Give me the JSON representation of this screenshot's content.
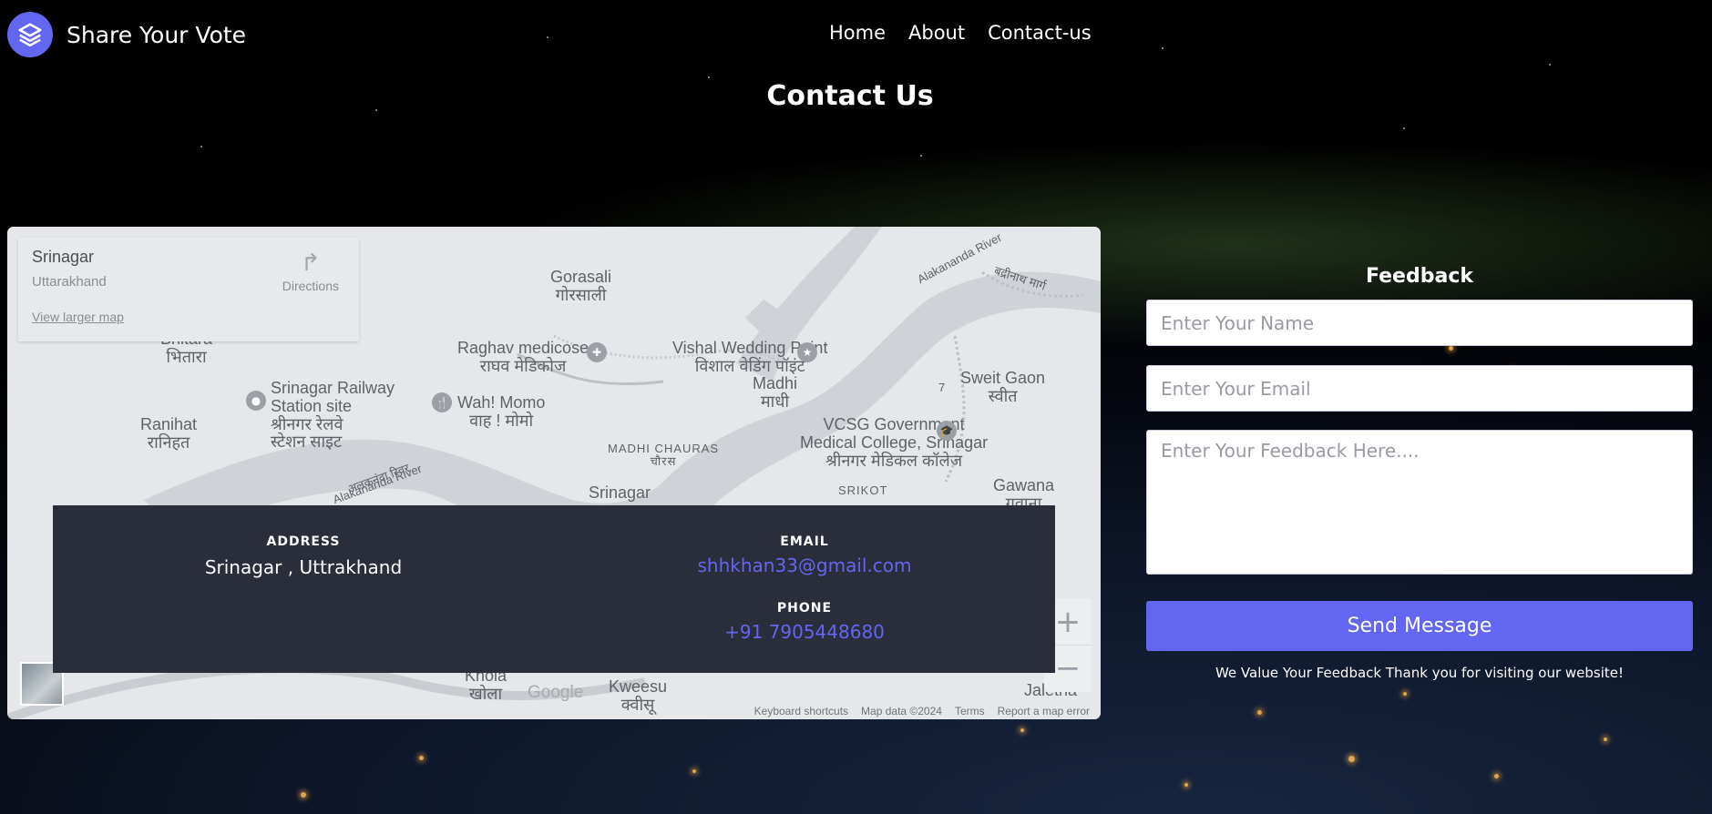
{
  "brand": {
    "name": "Share Your Vote",
    "logo_icon": "layers-icon",
    "accent": "#6366f1"
  },
  "nav": {
    "items": [
      {
        "label": "Home"
      },
      {
        "label": "About"
      },
      {
        "label": "Contact-us"
      }
    ]
  },
  "page": {
    "title": "Contact Us"
  },
  "map": {
    "place_card": {
      "title": "Srinagar",
      "subtitle": "Uttarakhand",
      "larger_map_link": "View larger map",
      "directions_label": "Directions",
      "directions_icon": "directions-arrow-icon"
    },
    "labels": {
      "gorasali": "Gorasali",
      "gorasali_hi": "गोरसाली",
      "bhitara": "Bhitara",
      "bhitara_hi": "भितारा",
      "raghav": "Raghav medicose",
      "raghav_hi": "राघव मेडिकोज",
      "vishal": "Vishal Wedding Point",
      "vishal_hi": "विशाल वेडिंग पॉइंट",
      "madhi": "Madhi",
      "madhi_hi": "माधी",
      "sweit": "Sweit Gaon",
      "sweit_hi": "स्वीत",
      "railway_1": "Srinagar Railway",
      "railway_2": "Station site",
      "railway_hi_1": "श्रीनगर रेलवे",
      "railway_hi_2": "स्टेशन साइट",
      "wahmomo": "Wah! Momo",
      "wahmomo_hi": "वाह ! मोमो",
      "ranihat": "Ranihat",
      "ranihat_hi": "रानिहत",
      "vcsg_1": "VCSG Government",
      "vcsg_2": "Medical College, Srinagar",
      "vcsg_hi": "श्रीनगर मेडिकल कॉलेज",
      "madhi_chauras": "MADHI CHAURAS",
      "chauras_hi": "चौरस",
      "srinagar": "Srinagar",
      "srikot": "SRIKOT",
      "gawana": "Gawana",
      "gawana_hi": "गवाना",
      "alaknanda_river": "Alakananda River",
      "alaknanda_hi": "अलकनंदा रिवर",
      "badrinath": "बद्रीनाथ मार्ग",
      "khola": "Khola",
      "khola_hi": "खोला",
      "kweesu": "Kweesu",
      "kweesu_hi": "क्वीसू",
      "jaletha": "Jaletha",
      "road_no": "7"
    },
    "google": "Google",
    "zoom_in": "+",
    "zoom_out": "−",
    "footer": {
      "shortcuts": "Keyboard shortcuts",
      "data": "Map data ©2024",
      "terms": "Terms",
      "report": "Report a map error"
    }
  },
  "contact": {
    "address_label": "ADDRESS",
    "address_value": "Srinagar , Uttrakhand",
    "email_label": "EMAIL",
    "email_value": "shhkhan33@gmail.com",
    "phone_label": "PHONE",
    "phone_value": "+91 7905448680"
  },
  "feedback": {
    "title": "Feedback",
    "name_placeholder": "Enter Your Name",
    "email_placeholder": "Enter Your Email",
    "message_placeholder": "Enter Your Feedback Here....",
    "send_label": "Send Message",
    "note": "We Value Your Feedback Thank you for visiting our website!"
  }
}
